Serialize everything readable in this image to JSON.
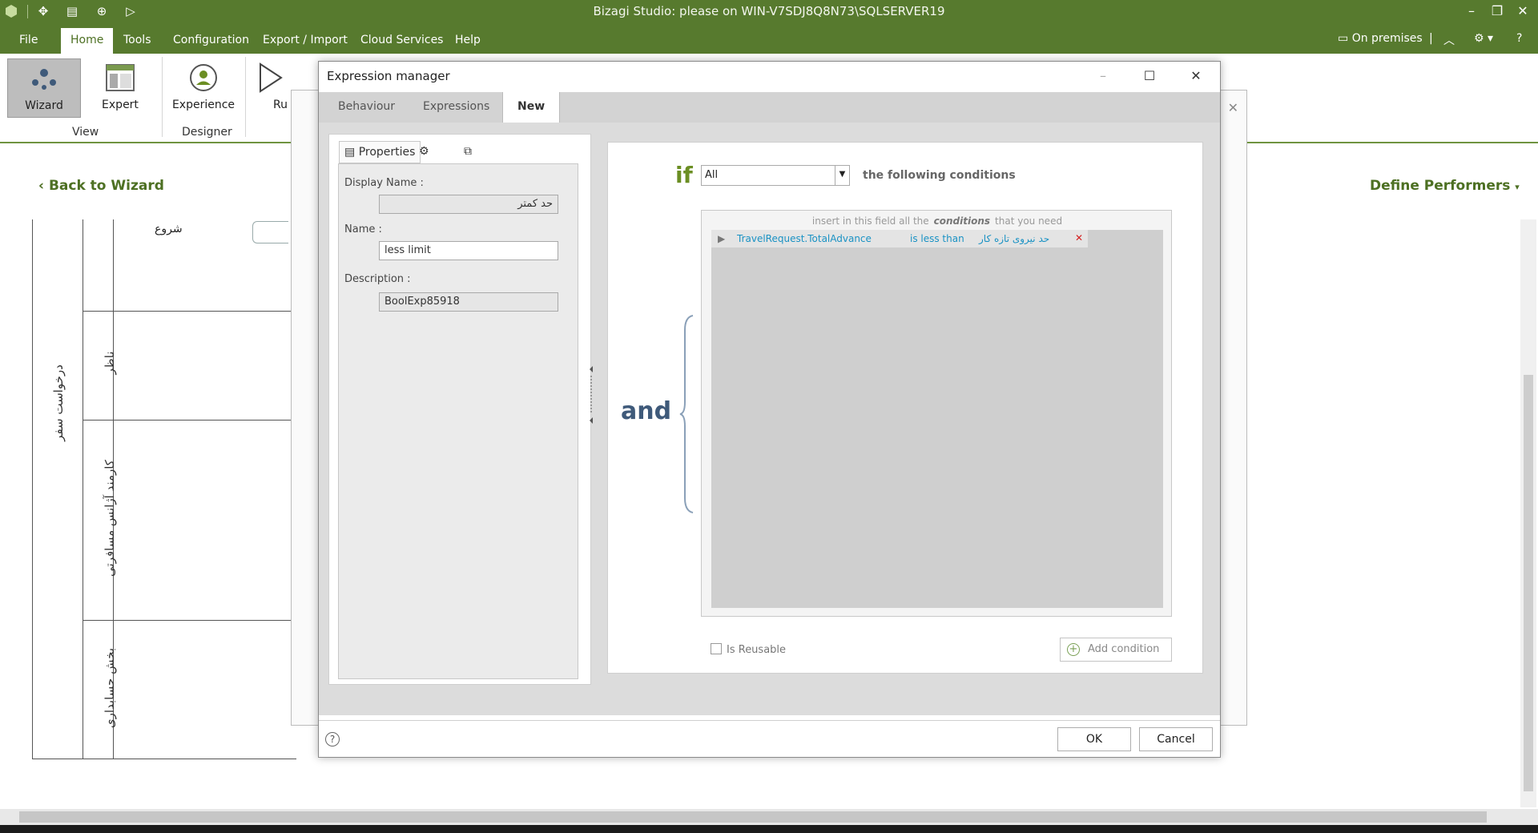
{
  "window": {
    "title": "Bizagi Studio: please  on WIN-V7SDJ8Q8N73\\SQLSERVER19",
    "controls": {
      "minimize": "–",
      "restore": "❐",
      "close": "✕"
    }
  },
  "menu": {
    "items": [
      "File",
      "Home",
      "Tools",
      "Configuration",
      "Export / Import",
      "Cloud Services",
      "Help"
    ],
    "active": "Home",
    "on_premises": "On premises"
  },
  "ribbon": {
    "wizard": "Wizard",
    "expert": "Expert",
    "experience": "Experience",
    "run": "Ru",
    "group_view": "View",
    "group_designer": "Designer"
  },
  "workarea": {
    "back_to_wizard": "Back to Wizard",
    "define_performers": "Define Performers",
    "pool_label": "درخواست سفر",
    "lanes": [
      "ناظر",
      "کارمند آژانس مسافرتی",
      "بخش حسابداری"
    ],
    "start_label": "شروع"
  },
  "dialog": {
    "title": "Expression manager",
    "tabs": [
      "Behaviour",
      "Expressions",
      "New"
    ],
    "active_tab": "New",
    "panel_tab": "Properties",
    "fields": {
      "display_name_label": "Display Name :",
      "display_name": "حد کمتر",
      "name_label": "Name :",
      "name": "less limit",
      "description_label": "Description :",
      "description": "BoolExp85918"
    },
    "condition": {
      "if": "if",
      "selector": "All",
      "following": "the following conditions",
      "hint_pre": "insert in this field all the",
      "hint_key": "conditions",
      "hint_post": "that you need",
      "and": "and",
      "row": {
        "attribute": "TravelRequest.TotalAdvance",
        "operator": "is less than",
        "value": "حد نیروی تازه کار"
      },
      "is_reusable": "Is Reusable",
      "add_condition": "Add condition"
    },
    "ok": "OK",
    "cancel": "Cancel"
  },
  "colors": {
    "brand_green": "#577a2e",
    "accent_green": "#6b8e23",
    "link_cyan": "#1a92c4"
  }
}
